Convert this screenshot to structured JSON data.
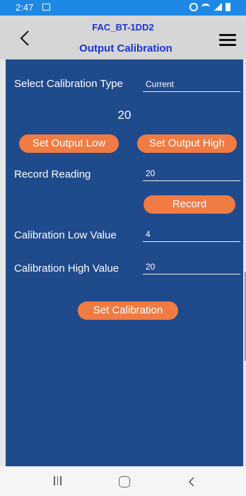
{
  "status_bar": {
    "time": "2:47"
  },
  "header": {
    "device_name": "FAC_BT-1DD2",
    "page_title": "Output Calibration"
  },
  "form": {
    "calibration_type": {
      "label": "Select Calibration Type",
      "value": "Current"
    },
    "current_value": "20",
    "set_output_low_label": "Set Output Low",
    "set_output_high_label": "Set Output High",
    "record_reading": {
      "label": "Record Reading",
      "value": "20"
    },
    "record_label": "Record",
    "cal_low": {
      "label": "Calibration Low Value",
      "value": "4"
    },
    "cal_high": {
      "label": "Calibration High Value",
      "value": "20"
    },
    "set_calibration_label": "Set Calibration"
  },
  "colors": {
    "status_bar": "#1e88e5",
    "header_bg": "#d6d6d6",
    "title": "#1b33d0",
    "panel_bg": "#1f4a8c",
    "button": "#f07b43"
  }
}
